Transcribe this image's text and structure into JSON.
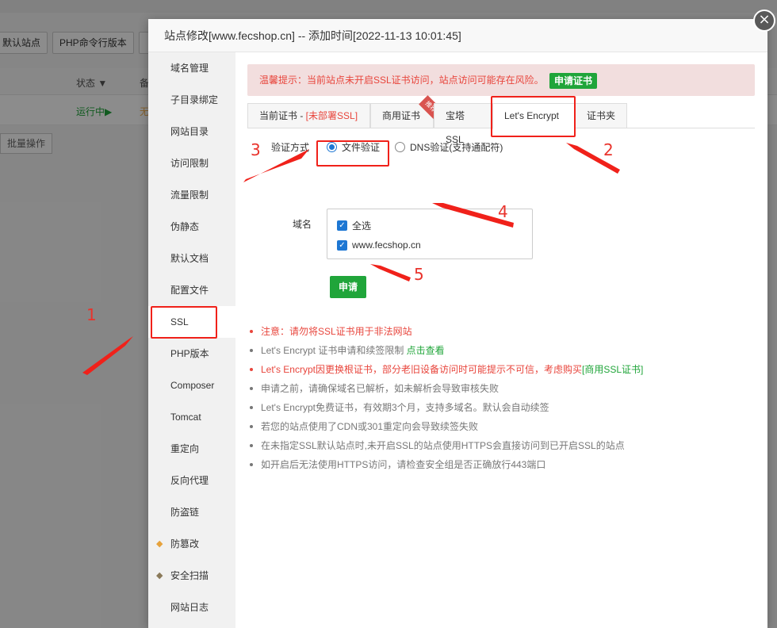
{
  "background": {
    "toolbar": [
      "默认站点",
      "PHP命令行版本"
    ],
    "table_headers": [
      "状态 ▼",
      "备"
    ],
    "row": {
      "status": "运行中▶",
      "ssl": "无"
    },
    "batch": "批量操作"
  },
  "dialog": {
    "title": "站点修改[www.fecshop.cn] -- 添加时间[2022-11-13 10:01:45]",
    "close": "×"
  },
  "sidebar": {
    "items": [
      {
        "label": "域名管理"
      },
      {
        "label": "子目录绑定"
      },
      {
        "label": "网站目录"
      },
      {
        "label": "访问限制"
      },
      {
        "label": "流量限制"
      },
      {
        "label": "伪静态"
      },
      {
        "label": "默认文档"
      },
      {
        "label": "配置文件"
      },
      {
        "label": "SSL",
        "active": true
      },
      {
        "label": "PHP版本"
      },
      {
        "label": "Composer"
      },
      {
        "label": "Tomcat"
      },
      {
        "label": "重定向"
      },
      {
        "label": "反向代理"
      },
      {
        "label": "防盗链"
      },
      {
        "label": "防篡改",
        "icon": "diamond-icon"
      },
      {
        "label": "安全扫描",
        "icon": "diamond-icon"
      },
      {
        "label": "网站日志"
      }
    ]
  },
  "alert": {
    "text": "温馨提示：当前站点未开启SSL证书访问，站点访问可能存在风险。",
    "button": "申请证书"
  },
  "tabs": {
    "current_prefix": "当前证书 - ",
    "current_status": "[未部署SSL]",
    "commercial": "商用证书",
    "commercial_badge": "推荐",
    "baota": "宝塔SSL",
    "letsencrypt": "Let's Encrypt",
    "folder": "证书夹"
  },
  "verify": {
    "label": "验证方式",
    "option_file": "文件验证",
    "option_dns": "DNS验证(支持通配符)",
    "selected": "文件验证"
  },
  "domain": {
    "label": "域名",
    "select_all": "全选",
    "domains": [
      "www.fecshop.cn"
    ]
  },
  "apply_button": "申请",
  "notes": {
    "n1": "注意：请勿将SSL证书用于非法网站",
    "n2_text": "Let's Encrypt 证书申请和续签限制 ",
    "n2_link": "点击查看",
    "n3_text": "Let's Encrypt因更换根证书，部分老旧设备访问时可能提示不可信，考虑购买",
    "n3_link": "[商用SSL证书]",
    "n4": "申请之前，请确保域名已解析，如未解析会导致审核失败",
    "n5": "Let's Encrypt免费证书，有效期3个月，支持多域名。默认会自动续签",
    "n6": "若您的站点使用了CDN或301重定向会导致续签失败",
    "n7": "在未指定SSL默认站点时,未开启SSL的站点使用HTTPS会直接访问到已开启SSL的站点",
    "n8": "如开启后无法使用HTTPS访问，请检查安全组是否正确放行443端口"
  },
  "annotations": {
    "n1": "1",
    "n2": "2",
    "n3": "3",
    "n4": "4",
    "n5": "5"
  },
  "colors": {
    "green": "#20a53a",
    "red": "#e8453c",
    "blue": "#1e77d3",
    "annotation_red": "#f0211a"
  }
}
